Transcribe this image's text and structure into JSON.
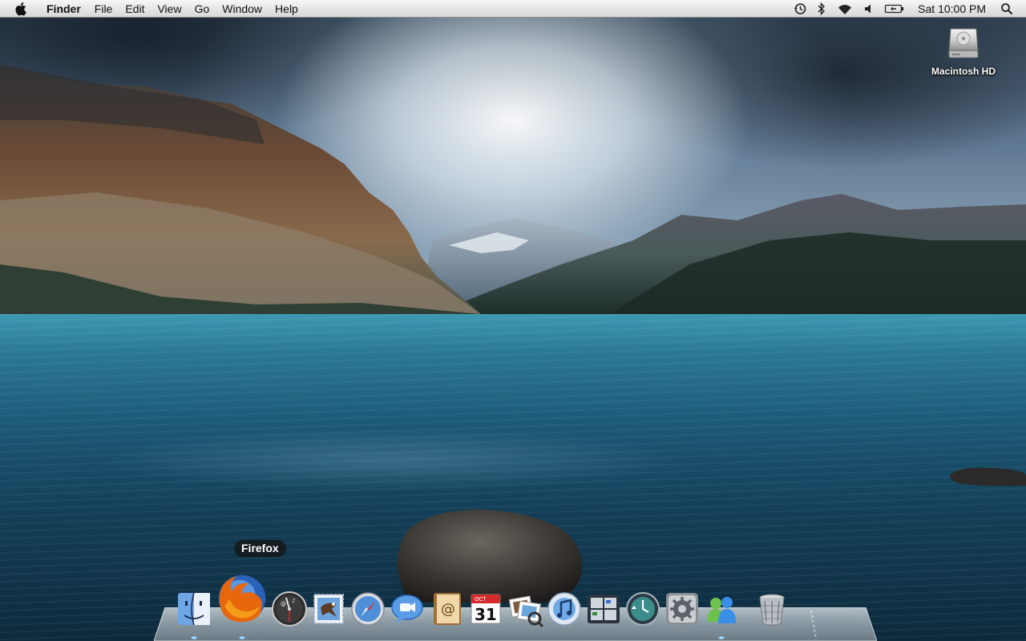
{
  "menubar": {
    "app_name": "Finder",
    "items": [
      "File",
      "Edit",
      "View",
      "Go",
      "Window",
      "Help"
    ],
    "status_icons": [
      "time-machine-icon",
      "bluetooth-icon",
      "wifi-icon",
      "volume-icon",
      "battery-icon"
    ],
    "clock": "Sat 10:00 PM",
    "spotlight_icon": "spotlight-search-icon"
  },
  "desktop": {
    "drive_label": "Macintosh HD"
  },
  "dock": {
    "tooltip": "Firefox",
    "apps": [
      "Finder",
      "Firefox",
      "Dashboard",
      "Mail",
      "Safari",
      "iChat",
      "Address Book",
      "iCal",
      "Preview",
      "iTunes",
      "Spaces",
      "Time Machine",
      "System Preferences",
      "Windows Live Messenger"
    ],
    "ical_month": "OCT",
    "ical_day": "31",
    "trash": "Trash"
  }
}
